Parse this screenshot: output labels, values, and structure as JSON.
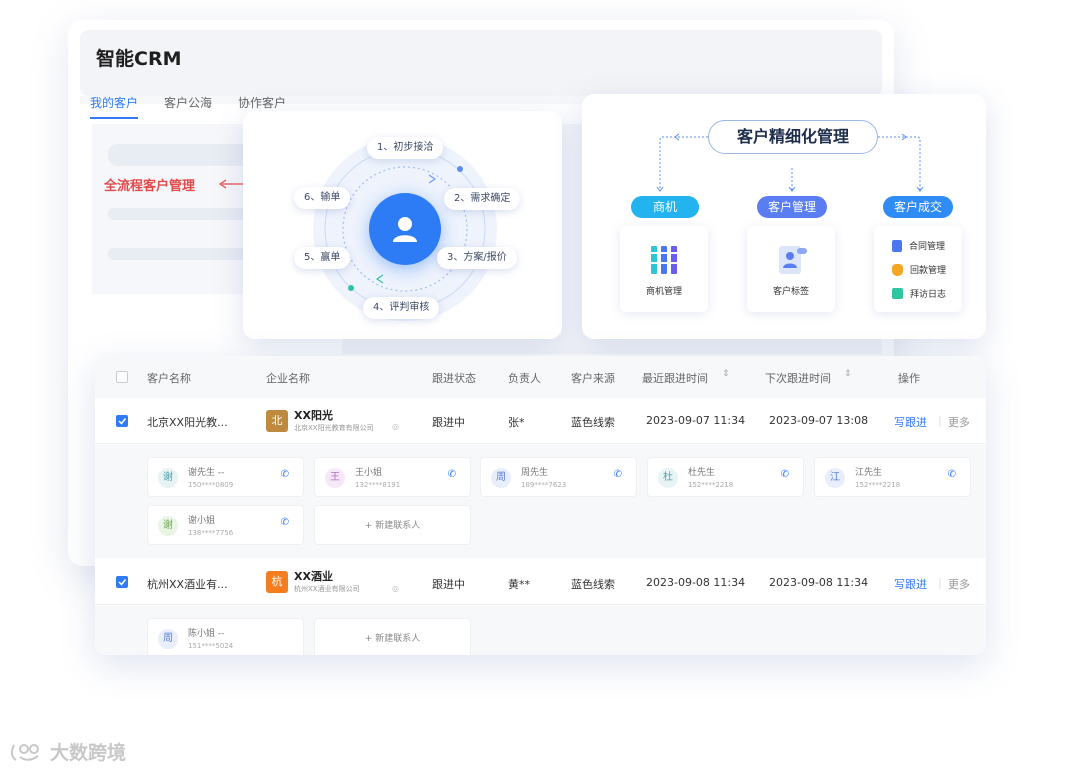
{
  "app": {
    "title": "智能CRM"
  },
  "tabs": [
    {
      "label": "我的客户",
      "active": true
    },
    {
      "label": "客户公海",
      "active": false
    },
    {
      "label": "协作客户",
      "active": false
    }
  ],
  "flow_label": "全流程客户管理",
  "cycle_steps": [
    "1、初步接洽",
    "2、需求确定",
    "3、方案/报价",
    "4、评判审核",
    "5、赢单",
    "6、输单"
  ],
  "management": {
    "title": "客户精细化管理",
    "categories": [
      {
        "label": "商机",
        "color": "#23b3ee",
        "sub": [
          "商机管理"
        ]
      },
      {
        "label": "客户管理",
        "color": "#5b7df2",
        "sub": [
          "客户标签"
        ]
      },
      {
        "label": "客户成交",
        "color": "#2f8cf5",
        "sub": [
          "合同管理",
          "回款管理",
          "拜访日志"
        ]
      }
    ]
  },
  "table": {
    "headers": [
      "客户名称",
      "企业名称",
      "跟进状态",
      "负责人",
      "客户来源",
      "最近跟进时间",
      "下次跟进时间",
      "操作"
    ],
    "rows": [
      {
        "customer": "北京XX阳光教...",
        "company_logo": "北",
        "company_name": "XX阳光",
        "company_full": "北京XX阳光教育有限公司",
        "status": "跟进中",
        "owner": "张*",
        "source": "蓝色线索",
        "last_follow": "2023-09-07 11:34",
        "next_follow": "2023-09-07 13:08",
        "action_primary": "写跟进",
        "action_more": "更多",
        "contacts": [
          {
            "avatar": "谢",
            "name": "谢先生 --",
            "phone": "150****0809"
          },
          {
            "avatar": "王",
            "name": "王小姐",
            "phone": "132****8191"
          },
          {
            "avatar": "周",
            "name": "周先生",
            "phone": "189****7623"
          },
          {
            "avatar": "杜",
            "name": "杜先生",
            "phone": "152****2218"
          },
          {
            "avatar": "江",
            "name": "江先生",
            "phone": "152****2218"
          },
          {
            "avatar": "谢",
            "name": "谢小姐",
            "phone": "138****7756"
          }
        ],
        "add_contact": "+ 新建联系人"
      },
      {
        "customer": "杭州XX酒业有...",
        "company_logo": "杭",
        "company_name": "XX酒业",
        "company_full": "杭州XX酒业有限公司",
        "status": "跟进中",
        "owner": "黄**",
        "source": "蓝色线索",
        "last_follow": "2023-09-08 11:34",
        "next_follow": "2023-09-08 11:34",
        "action_primary": "写跟进",
        "action_more": "更多",
        "contacts": [
          {
            "avatar": "周",
            "name": "陈小姐 --",
            "phone": "151****5024"
          }
        ],
        "add_contact": "+ 新建联系人"
      }
    ]
  },
  "watermark": "大数跨境"
}
